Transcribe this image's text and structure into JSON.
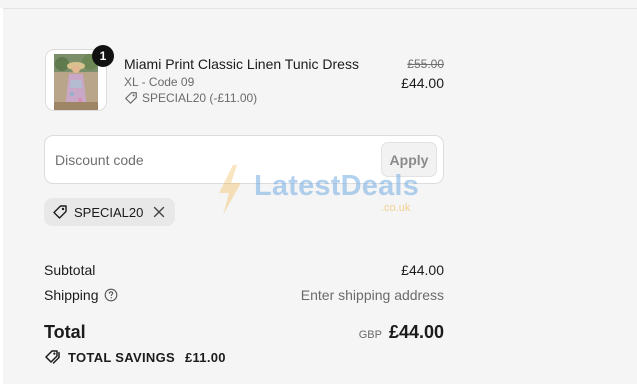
{
  "product": {
    "quantity": "1",
    "name": "Miami Print Classic Linen Tunic Dress",
    "variant": "XL - Code 09",
    "discount_tag": "SPECIAL20 (-£11.00)",
    "price_original": "£55.00",
    "price_current": "£44.00",
    "image_icon": "product-photo"
  },
  "discount": {
    "placeholder": "Discount code",
    "value": "",
    "apply_label": "Apply"
  },
  "watermark": {
    "brand": "LatestDeals",
    "domain": ".co.uk"
  },
  "applied_code": {
    "code": "SPECIAL20",
    "icon": "tag-icon",
    "remove_icon": "close-icon"
  },
  "summary": {
    "subtotal_label": "Subtotal",
    "subtotal_value": "£44.00",
    "shipping_label": "Shipping",
    "shipping_value": "Enter shipping address",
    "total_label": "Total",
    "currency": "GBP",
    "total_value": "£44.00",
    "savings_label": "TOTAL SAVINGS",
    "savings_value": "£11.00"
  },
  "colors": {
    "background": "#f5f5f5",
    "text": "#1b1b1b",
    "muted": "#6b6b6b",
    "badge": "#111111"
  }
}
